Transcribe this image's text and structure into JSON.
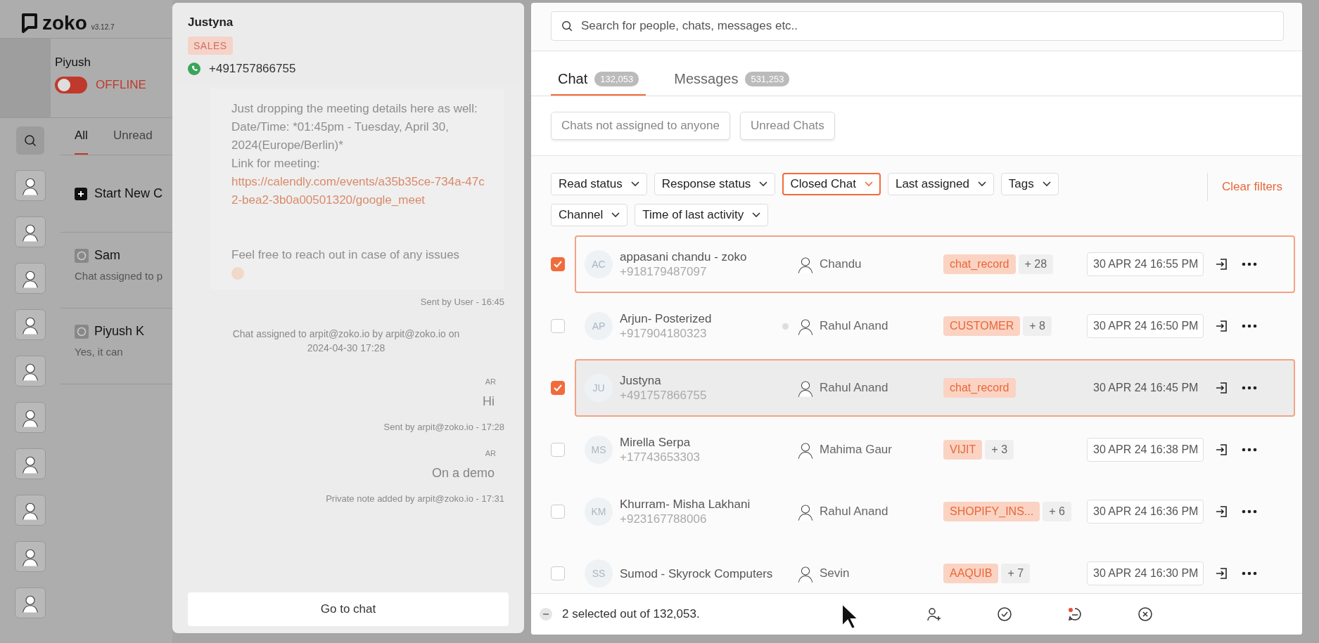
{
  "app": {
    "logo": "zoko",
    "version": "v3.12.7"
  },
  "profile": {
    "name": "Piyush",
    "online": false,
    "status": "OFFLINE"
  },
  "inbox_tabs": [
    {
      "label": "All",
      "selected": true
    },
    {
      "label": "Unread",
      "selected": false
    }
  ],
  "start_new_chat": "Start New C",
  "chats": [
    {
      "name": "Sam",
      "preview": "Chat assigned to p"
    },
    {
      "name": "Piyush K",
      "preview": "Yes, it can"
    }
  ],
  "preview": {
    "name": "Justyna",
    "tag": "SALES",
    "phone": "+491757866755",
    "button": "Go to chat",
    "messages": [
      {
        "kind": "incoming",
        "text": "Just dropping the meeting details here as well:\nDate/Time: *01:45pm - Tuesday, April 30, 2024(Europe/Berlin)*\nLink for meeting:",
        "link": "https://calendly.com/events/a35b35ce-734a-47c2-bea2-3b0a00501320/google_meet",
        "after": "Feel free to reach out in case of any issues",
        "meta": "Sent by User - 16:45"
      },
      {
        "kind": "system",
        "text": "Chat assigned to arpit@zoko.io by arpit@zoko.io on 2024-04-30 17:28"
      },
      {
        "kind": "outgoing",
        "initials": "AR",
        "text": "Hi",
        "meta": "Sent by arpit@zoko.io - 17:28"
      },
      {
        "kind": "note",
        "initials": "AR",
        "text": "On a demo",
        "meta": "Private note added by arpit@zoko.io - 17:31"
      }
    ]
  },
  "search": {
    "placeholder": "Search for people, chats, messages etc.."
  },
  "tabs": [
    {
      "label": "Chat",
      "count": "132,053",
      "selected": true
    },
    {
      "label": "Messages",
      "count": "531,253",
      "selected": false
    }
  ],
  "quick_filters": [
    "Chats not assigned to anyone",
    "Unread Chats"
  ],
  "filters": [
    {
      "label": "Read status",
      "active": false
    },
    {
      "label": "Response status",
      "active": false
    },
    {
      "label": "Closed Chat",
      "active": true
    },
    {
      "label": "Last assigned",
      "active": false
    },
    {
      "label": "Tags",
      "active": false
    },
    {
      "label": "Channel",
      "active": false
    },
    {
      "label": "Time of last activity",
      "active": false
    }
  ],
  "clear_filters": "Clear filters",
  "rows": [
    {
      "initials": "AC",
      "name": "appasani chandu - zoko",
      "phone": "+918179487097",
      "unread": false,
      "agent": "Chandu",
      "tag": "chat_record",
      "more_tags": "+ 28",
      "time": "30 APR 24 16:55 PM",
      "selected": true,
      "active": false
    },
    {
      "initials": "AP",
      "name": "Arjun- Posterized",
      "phone": "+917904180323",
      "unread": true,
      "agent": "Rahul Anand",
      "tag": "CUSTOMER",
      "more_tags": "+ 8",
      "time": "30 APR 24 16:50 PM",
      "selected": false,
      "active": false
    },
    {
      "initials": "JU",
      "name": "Justyna",
      "phone": "+491757866755",
      "unread": false,
      "agent": "Rahul Anand",
      "tag": "chat_record",
      "time": "30 APR 24 16:45 PM",
      "selected": true,
      "active": true
    },
    {
      "initials": "MS",
      "name": "Mirella Serpa",
      "phone": "+17743653303",
      "unread": false,
      "agent": "Mahima Gaur",
      "tag": "VIJIT",
      "more_tags": "+ 3",
      "time": "30 APR 24 16:38 PM",
      "selected": false,
      "active": false
    },
    {
      "initials": "KM",
      "name": "Khurram- Misha Lakhani",
      "phone": "+923167788006",
      "unread": false,
      "agent": "Rahul Anand",
      "tag": "SHOPIFY_INS...",
      "more_tags": "+ 6",
      "time": "30 APR 24 16:36 PM",
      "selected": false,
      "active": false
    },
    {
      "initials": "SS",
      "name": "Sumod - Skyrock Computers",
      "unread": false,
      "agent": "Sevin",
      "tag": "AAQUIB",
      "more_tags": "+ 7",
      "time": "30 APR 24 16:30 PM",
      "selected": false,
      "active": false
    }
  ],
  "footer": {
    "summary": "2 selected out of 132,053."
  }
}
